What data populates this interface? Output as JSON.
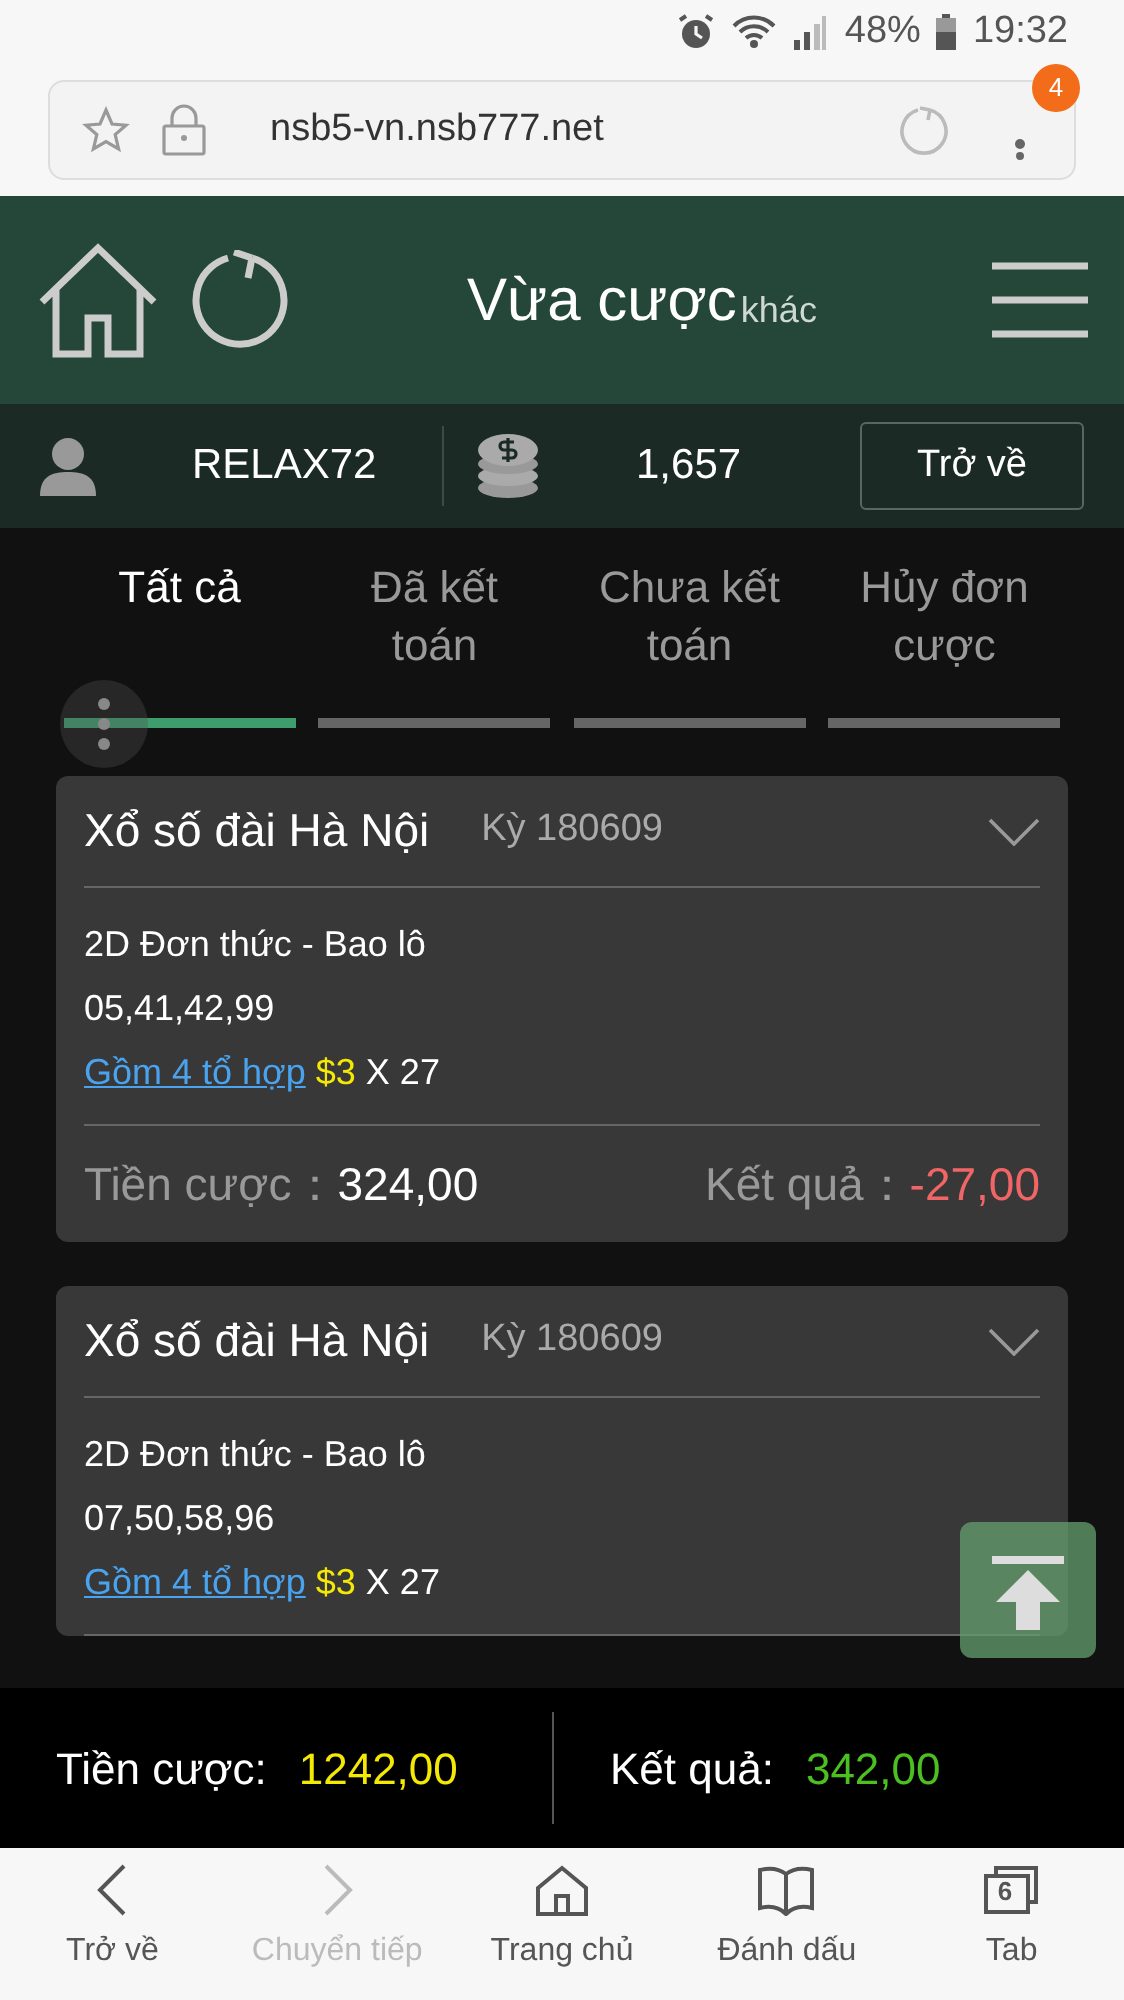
{
  "status_bar": {
    "battery": "48%",
    "time": "19:32"
  },
  "browser": {
    "url": "nsb5-vn.nsb777.net",
    "menu_badge": "4"
  },
  "header": {
    "title": "Vừa cược",
    "subtitle": "khác"
  },
  "user_bar": {
    "username": "RELAX72",
    "balance": "1,657",
    "back_button": "Trở về"
  },
  "tabs": [
    {
      "label": "Tất cả",
      "selected": true
    },
    {
      "label": "Đã kết toán",
      "selected": false
    },
    {
      "label": "Chưa kết toán",
      "selected": false
    },
    {
      "label": "Hủy đơn cược",
      "selected": false
    }
  ],
  "bets": [
    {
      "title": "Xổ số đài Hà Nội",
      "period": "Kỳ 180609",
      "bet_type": "2D Đơn thức - Bao lô",
      "numbers": "05,41,42,99",
      "combo_link": "Gồm 4 tổ hợp",
      "price": "$3",
      "multiplier": "X 27",
      "stake_label": "Tiền cược：",
      "stake": "324,00",
      "result_label": "Kết quả：",
      "result": "-27,00"
    },
    {
      "title": "Xổ số đài Hà Nội",
      "period": "Kỳ 180609",
      "bet_type": "2D Đơn thức - Bao lô",
      "numbers": "07,50,58,96",
      "combo_link": "Gồm 4 tổ hợp",
      "price": "$3",
      "multiplier": "X 27"
    }
  ],
  "summary": {
    "stake_label": "Tiền cược:",
    "stake": "1242,00",
    "result_label": "Kết quả:",
    "result": "342,00"
  },
  "browser_nav": [
    {
      "kind": "back",
      "label": "Trở về",
      "disabled": false
    },
    {
      "kind": "forward",
      "label": "Chuyển tiếp",
      "disabled": true
    },
    {
      "kind": "home",
      "label": "Trang chủ",
      "disabled": false
    },
    {
      "kind": "bookmark",
      "label": "Đánh dấu",
      "disabled": false
    },
    {
      "kind": "tabs",
      "label": "Tab",
      "disabled": false,
      "count": "6"
    }
  ]
}
